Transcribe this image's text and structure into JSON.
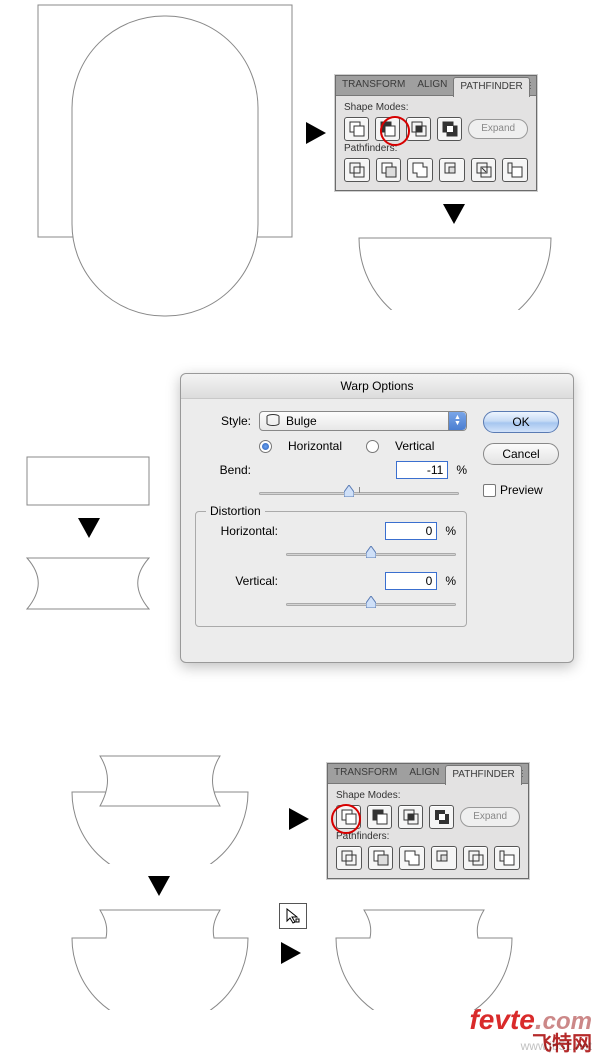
{
  "pathfinder_panel": {
    "tabs": {
      "transform": "TRANSFORM",
      "align": "ALIGN",
      "pathfinder": "PATHFINDER"
    },
    "shape_modes_label": "Shape Modes:",
    "pathfinders_label": "Pathfinders:",
    "expand_label": "Expand",
    "shape_mode_icons": [
      "unite-icon",
      "minus-front-icon",
      "intersect-icon",
      "exclude-icon"
    ],
    "pathfinder_icons": [
      "divide-icon",
      "trim-icon",
      "merge-icon",
      "crop-icon",
      "outline-icon",
      "minus-back-icon"
    ]
  },
  "warp_dialog": {
    "title": "Warp Options",
    "style_label": "Style:",
    "style_value": "Bulge",
    "horizontal_label": "Horizontal",
    "vertical_label": "Vertical",
    "bend_label": "Bend:",
    "bend_value": "-11",
    "pct": "%",
    "distortion_label": "Distortion",
    "dist_h_label": "Horizontal:",
    "dist_h_value": "0",
    "dist_v_label": "Vertical:",
    "dist_v_value": "0",
    "ok_label": "OK",
    "cancel_label": "Cancel",
    "preview_label": "Preview"
  },
  "watermark": {
    "brand": "fevte",
    "dot": ".",
    "com": "com",
    "sub": "飞特网",
    "faint": "www.jb51.net"
  }
}
